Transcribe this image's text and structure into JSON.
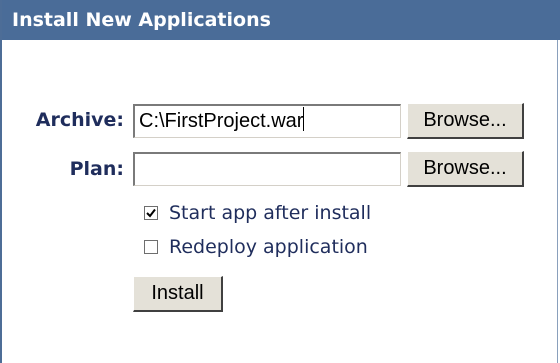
{
  "header": {
    "title": "Install New Applications"
  },
  "form": {
    "archive_label": "Archive:",
    "archive_value": "C:\\FirstProject.war",
    "plan_label": "Plan:",
    "plan_value": "",
    "browse_label": "Browse...",
    "start_app": {
      "label": "Start app after install",
      "checked": true
    },
    "redeploy": {
      "label": "Redeploy application",
      "checked": false
    },
    "install_label": "Install"
  }
}
